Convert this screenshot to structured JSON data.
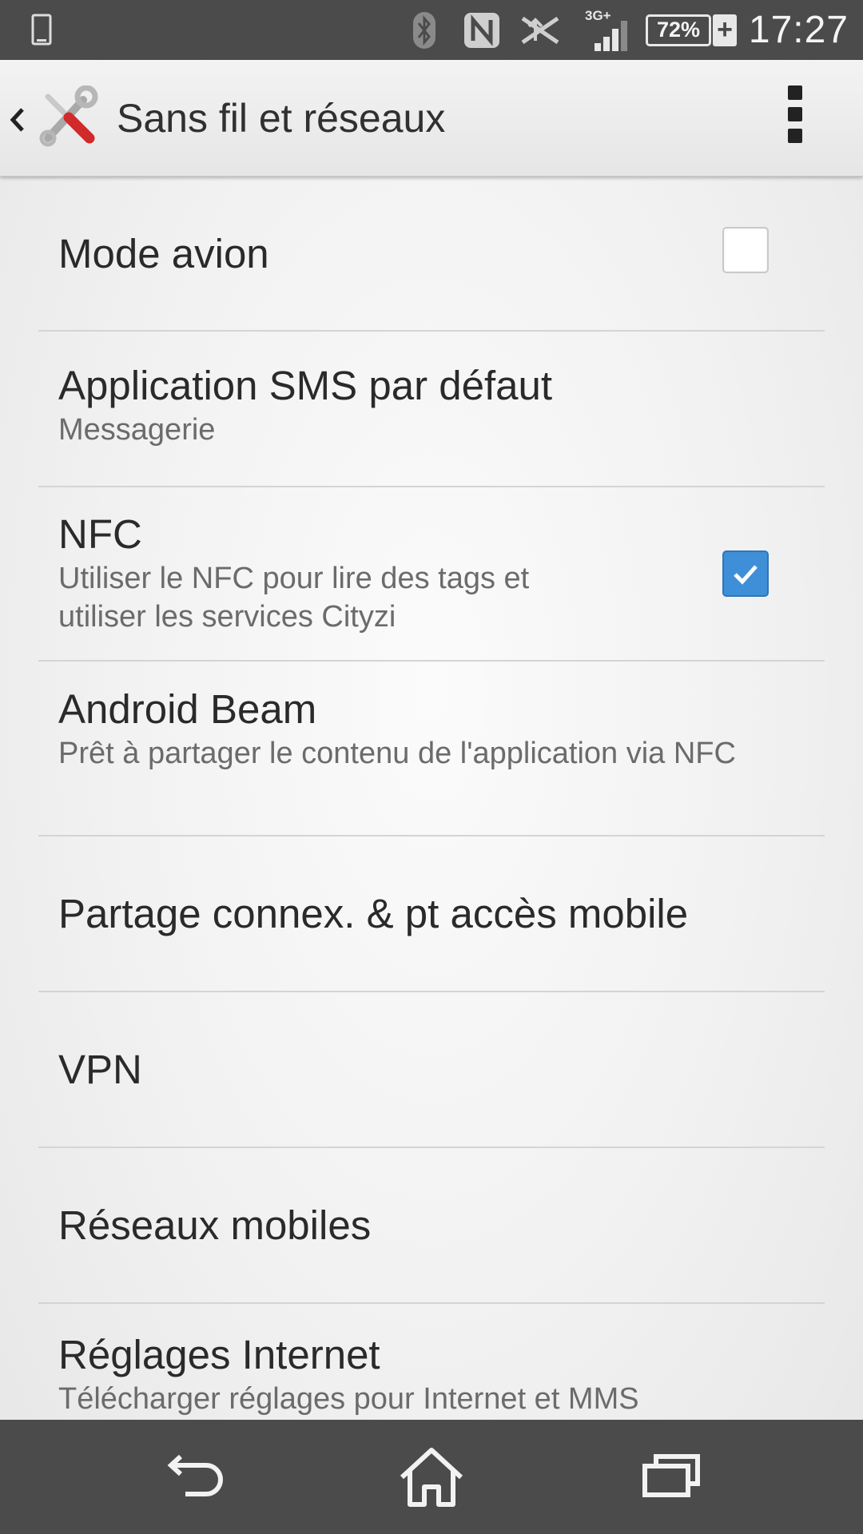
{
  "status_bar": {
    "time": "17:27",
    "battery_percent": "72%",
    "network_type": "3G+",
    "icons": [
      "phone-icon",
      "bluetooth-icon",
      "nfc-icon",
      "data-transfer-icon",
      "signal-icon",
      "battery-icon",
      "charging-icon"
    ]
  },
  "action_bar": {
    "title": "Sans fil et réseaux"
  },
  "settings": {
    "airplane": {
      "title": "Mode avion",
      "checked": false
    },
    "sms": {
      "title": "Application SMS par défaut",
      "summary": "Messagerie"
    },
    "nfc": {
      "title": "NFC",
      "summary": "Utiliser le NFC pour lire des tags et utiliser les services Cityzi",
      "checked": true
    },
    "beam": {
      "title": "Android Beam",
      "summary": "Prêt à partager le contenu de l'application via NFC"
    },
    "tethering": {
      "title": "Partage connex. & pt accès mobile"
    },
    "vpn": {
      "title": "VPN"
    },
    "mobile": {
      "title": "Réseaux mobiles"
    },
    "internet": {
      "title": "Réglages Internet",
      "summary": "Télécharger réglages pour Internet et MMS"
    }
  },
  "nav_bar": {
    "icons": [
      "back-icon",
      "home-icon",
      "recents-icon"
    ]
  },
  "colors": {
    "accent": "#3e8fd8",
    "status_bar": "#4b4b4b"
  }
}
